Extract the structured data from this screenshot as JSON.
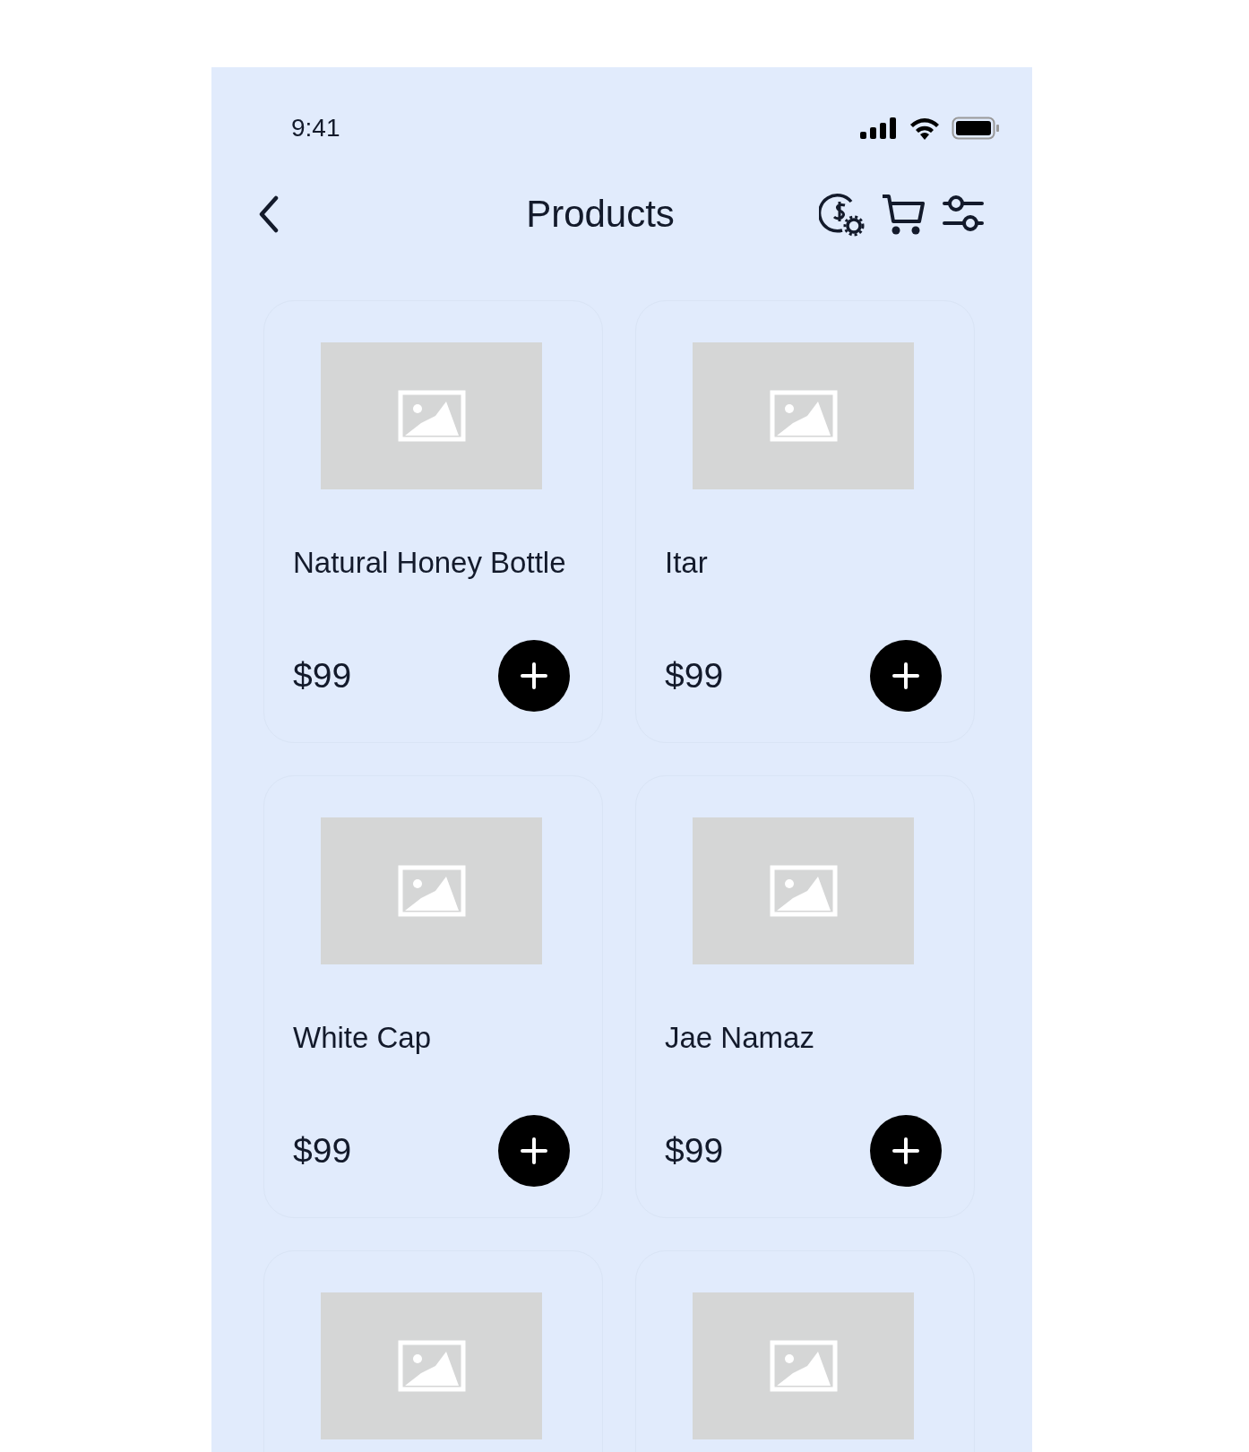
{
  "status_bar": {
    "time": "9:41"
  },
  "header": {
    "title": "Products"
  },
  "products": [
    {
      "image": {
        "kind": "placeholder"
      },
      "name": "Natural Honey Bottle",
      "price": "$99"
    },
    {
      "image": {
        "kind": "placeholder"
      },
      "name": "Itar",
      "price": "$99"
    },
    {
      "image": {
        "kind": "placeholder"
      },
      "name": "White Cap",
      "price": "$99"
    },
    {
      "image": {
        "kind": "placeholder"
      },
      "name": "Jae Namaz",
      "price": "$99"
    },
    {
      "image": {
        "kind": "placeholder"
      }
    },
    {
      "image": {
        "kind": "placeholder"
      }
    }
  ]
}
